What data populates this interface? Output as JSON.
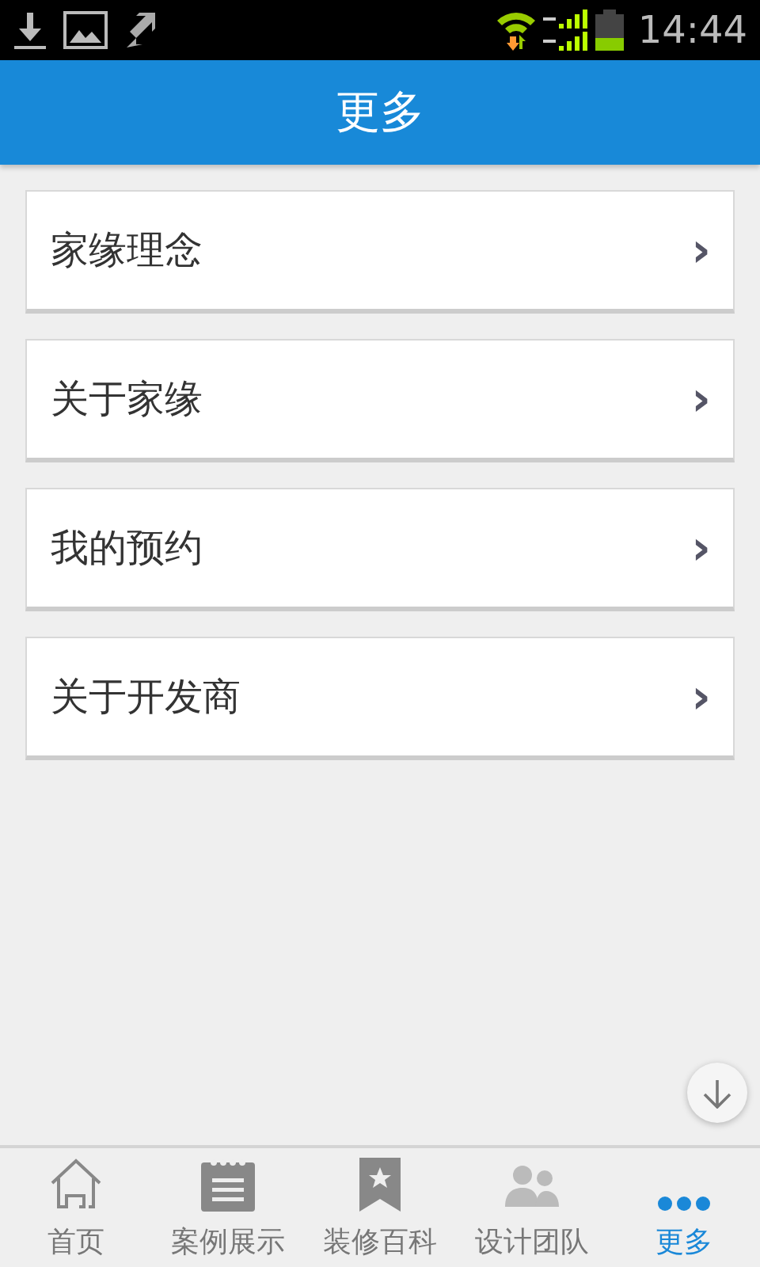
{
  "status_bar": {
    "time": "14:44"
  },
  "header": {
    "title": "更多"
  },
  "menu_items": [
    {
      "label": "家缘理念",
      "chevron": "›"
    },
    {
      "label": "关于家缘",
      "chevron": "›"
    },
    {
      "label": "我的预约",
      "chevron": "›"
    },
    {
      "label": "关于开发商",
      "chevron": "›"
    }
  ],
  "tabs": [
    {
      "kind": "home",
      "label": "首页",
      "selected": false
    },
    {
      "kind": "notepad",
      "label": "案例展示",
      "selected": false
    },
    {
      "kind": "bookmark",
      "label": "装修百科",
      "selected": false
    },
    {
      "kind": "people",
      "label": "设计团队",
      "selected": false
    },
    {
      "kind": "dots",
      "label": "更多",
      "selected": true
    }
  ]
}
